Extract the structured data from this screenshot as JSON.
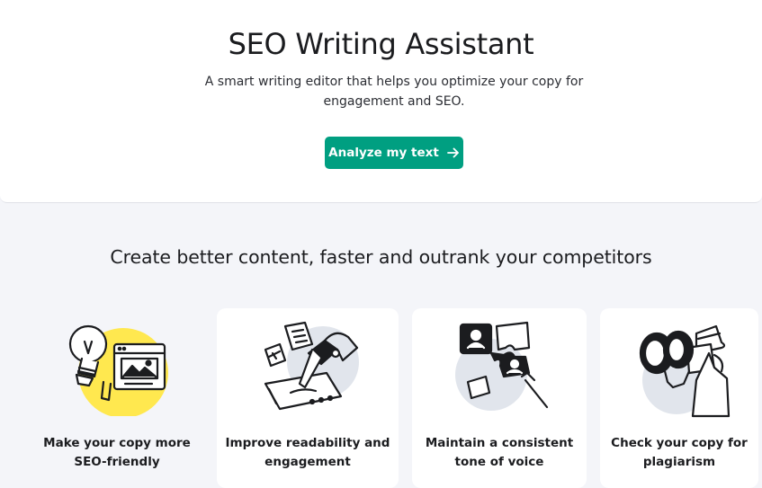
{
  "hero": {
    "title": "SEO Writing Assistant",
    "subtitle": "A smart writing editor that helps you optimize your copy for engagement and SEO.",
    "cta_label": "Analyze my text",
    "cta_icon": "arrow-right-icon"
  },
  "section": {
    "title": "Create better content, faster and outrank your competitors"
  },
  "features": [
    {
      "label": "Make your copy more SEO-friendly",
      "icon": "lightbulb-browser-icon"
    },
    {
      "label": "Improve readability and engagement",
      "icon": "hand-writing-icon"
    },
    {
      "label": "Maintain a consistent tone of voice",
      "icon": "puzzle-people-icon"
    },
    {
      "label": "Check your copy for plagiarism",
      "icon": "binoculars-detective-icon"
    }
  ],
  "colors": {
    "accent": "#009f81",
    "highlight_yellow": "#ffe84f",
    "illustration_gray": "#e1e5ec",
    "background": "#f4f5f9"
  }
}
